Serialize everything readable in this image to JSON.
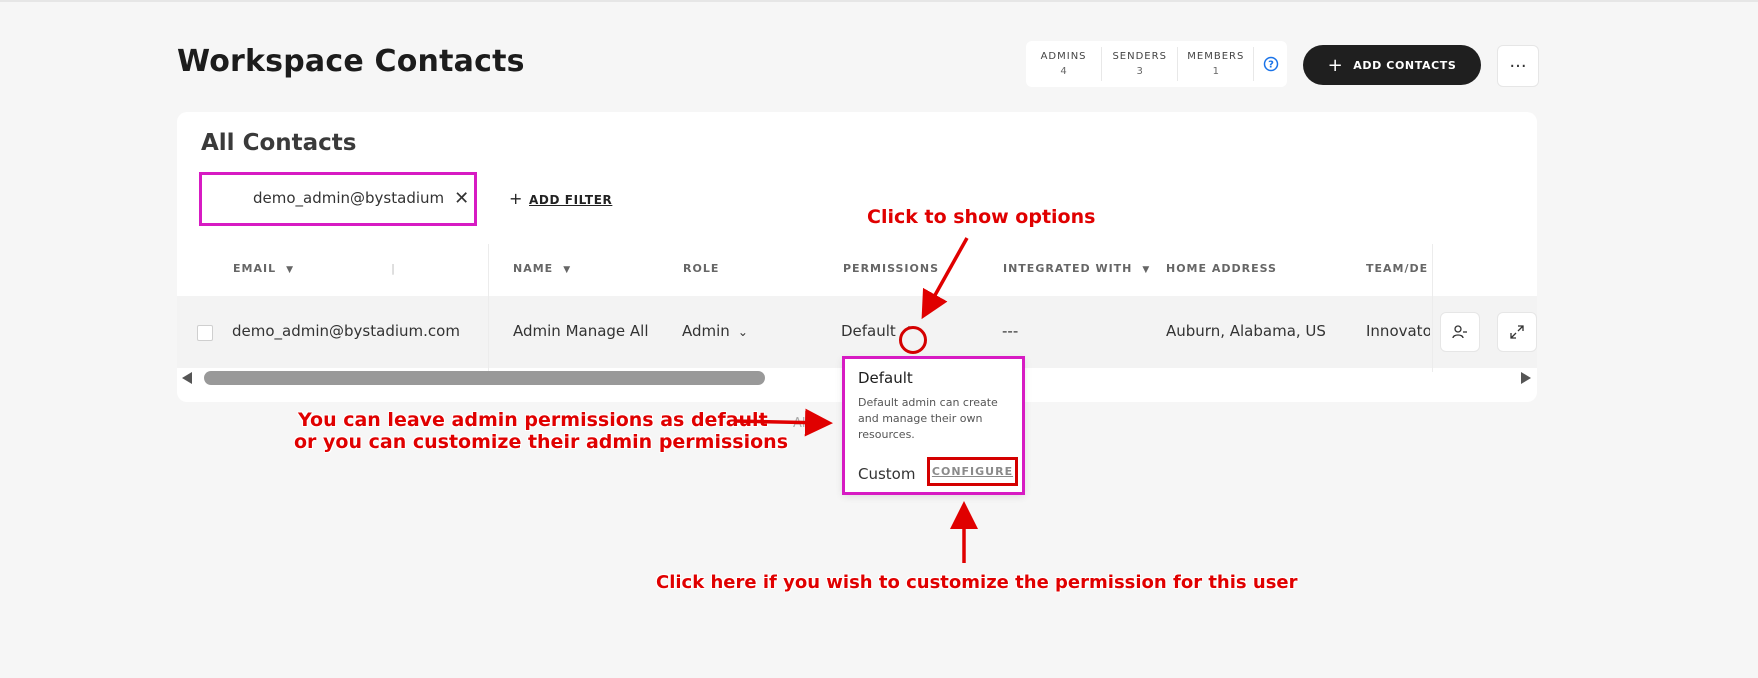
{
  "page": {
    "title": "Workspace Contacts"
  },
  "stats": [
    {
      "label": "ADMINS",
      "value": "4"
    },
    {
      "label": "SENDERS",
      "value": "3"
    },
    {
      "label": "MEMBERS",
      "value": "1"
    }
  ],
  "header": {
    "add_contacts_label": "ADD CONTACTS",
    "more_label": "···"
  },
  "card": {
    "title": "All Contacts",
    "filter_value": "demo_admin@bystadium",
    "add_filter_label": "ADD FILTER"
  },
  "table": {
    "columns": [
      "EMAIL",
      "NAME",
      "ROLE",
      "PERMISSIONS",
      "INTEGRATED WITH",
      "HOME ADDRESS",
      "TEAM/DEI"
    ],
    "row": {
      "email": "demo_admin@bystadium.com",
      "name": "Admin Manage All",
      "role": "Admin",
      "permissions": "Default",
      "integrated_with": "---",
      "home_address": "Auburn, Alabama, US",
      "team": "Innovato"
    },
    "under_text": "All"
  },
  "dropdown": {
    "title": "Default",
    "description": "Default admin can create and manage their own resources.",
    "custom_label": "Custom",
    "configure_label": "CONFIGURE"
  },
  "annotations": {
    "show_options": "Click to show options",
    "leave_default_line1": "You can leave admin permissions as default",
    "leave_default_line2": "or you can customize their admin permissions",
    "customize": "Click here if you wish to customize the permission for this user"
  },
  "colors": {
    "annotation": "#e00000",
    "highlight_magenta": "#d71bc3",
    "button_dark": "#1f1f1f",
    "help_blue": "#1a73e8"
  },
  "icons": [
    "help-circle-icon",
    "plus-icon",
    "more-icon",
    "close-icon",
    "sort-caret-icon",
    "chevron-down-icon",
    "chevron-up-icon",
    "remove-user-icon",
    "expand-icon"
  ]
}
